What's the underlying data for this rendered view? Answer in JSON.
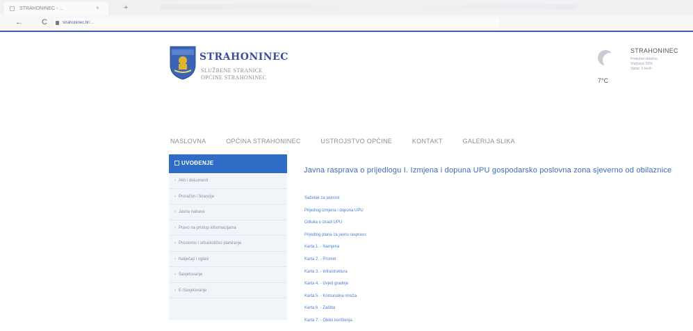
{
  "browser": {
    "tab_title": "STRAHONINEC - ...",
    "tab_close": "×",
    "new_tab": "+",
    "back": "←",
    "reload": "C",
    "url_host": "strahoninec.hr",
    "url_rest": "/..."
  },
  "header": {
    "site_name": "STRAHONINEC",
    "subtitle_line1": "SLUŽBENE STRANICE",
    "subtitle_line2": "OPĆINE STRAHONINEC"
  },
  "weather": {
    "city": "STRAHONINEC",
    "detail_line1": "Pretežno oblačno",
    "detail_line2": "Vlažnost: 82%",
    "detail_line3": "Vjetar: 5 km/h",
    "temperature": "7°C",
    "icon": "moon-icon"
  },
  "menu": {
    "items": [
      "NASLOVNA",
      "OPĆINA STRAHONINEC",
      "USTROJSTVO OPĆINE",
      "KONTAKT",
      "GALERIJA SLIKA"
    ]
  },
  "sidebar": {
    "title": "UVOĐENJE",
    "items": [
      "Akti i dokumenti",
      "Proračun i financije",
      "Javna nabava",
      "Pravo na pristup informacijama",
      "Prostorno i urbanističko planiranje",
      "Natječaji i oglasi",
      "Savjetovanje",
      "E-Savjetovanje"
    ]
  },
  "content": {
    "title": "Javna rasprava o prijedlogu I. Izmjena i dopuna UPU gospodarsko poslovna zona sjeverno od obilaznice",
    "links": [
      "Sažetak za javnost",
      "Prijedlog izmjena i dopuna UPU",
      "Odluka o izradi UPU",
      "Prijedlog plana za javnu raspravu",
      "Karta 1. - Namjena",
      "Karta 2. - Promet",
      "Karta 3. - Infrastruktura",
      "Karta 4. - Uvjeti gradnje",
      "Karta 5. - Komunalna mreža",
      "Karta 6. - Zaštita",
      "Karta 7. - Oblici korištenja"
    ]
  },
  "colors": {
    "brand_blue": "#2f6cc6",
    "title_blue": "#3a4f96",
    "link_blue": "#4a7fcf"
  }
}
